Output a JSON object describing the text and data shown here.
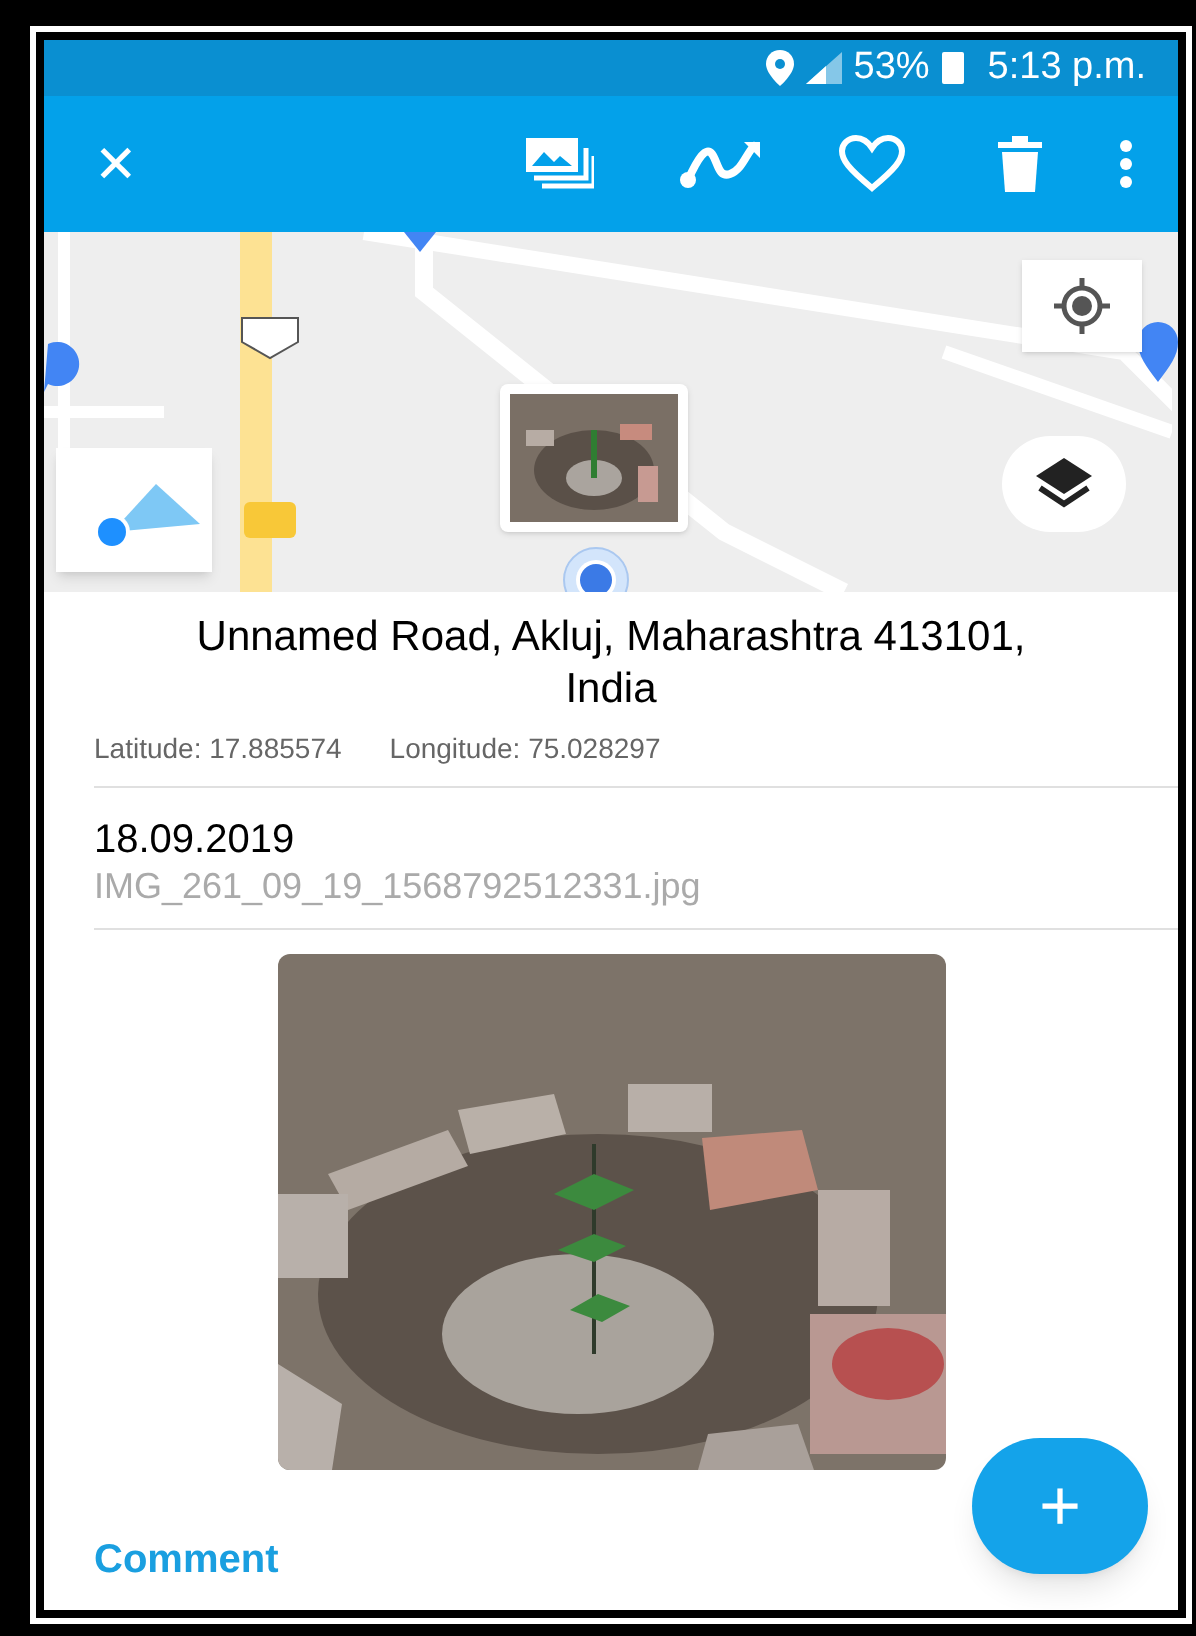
{
  "status_bar": {
    "battery": "53%",
    "time": "5:13 p.m."
  },
  "toolbar": {
    "close": "✕"
  },
  "location": {
    "address": "Unnamed Road, Akluj, Maharashtra 413101, India",
    "latitude": "Latitude: 17.885574",
    "longitude": "Longitude: 75.028297"
  },
  "photo_info": {
    "date": "18.09.2019",
    "filename": "IMG_261_09_19_1568792512331.jpg"
  },
  "comment_link": "Comment",
  "fab": "+"
}
